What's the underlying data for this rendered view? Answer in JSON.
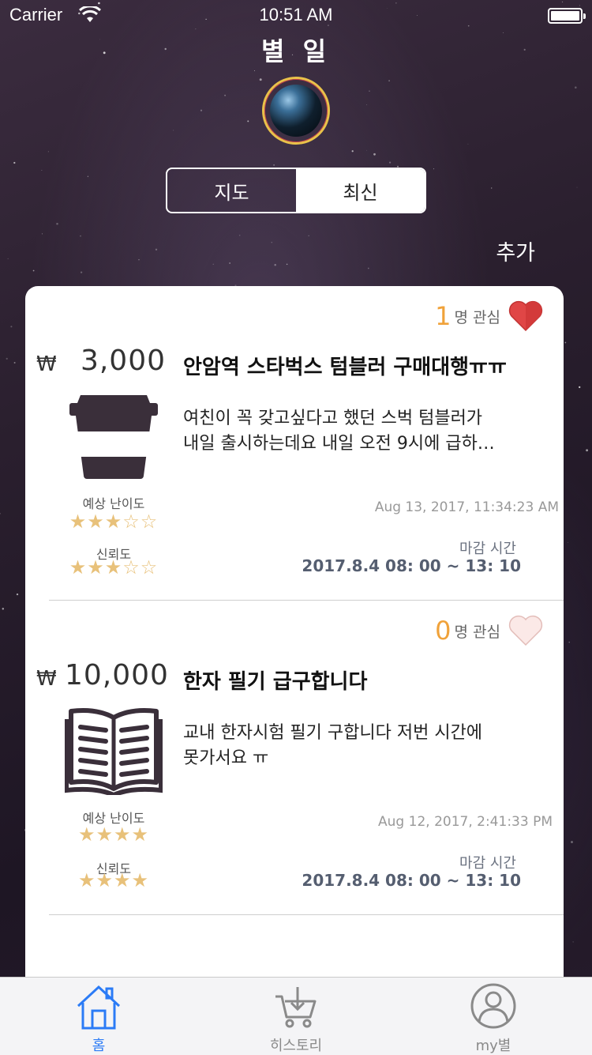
{
  "status_bar": {
    "carrier": "Carrier",
    "time": "10:51 AM",
    "battery_level": 1.0
  },
  "header": {
    "title": "별 일"
  },
  "segmented_control": {
    "map_label": "지도",
    "latest_label": "최신",
    "selected": "최신"
  },
  "add_label": "추가",
  "currency_symbol": "₩",
  "posts": [
    {
      "interest_count": "1",
      "interest_label": "명 관심",
      "liked": true,
      "price": "3,000",
      "title": "안암역 스타벅스 텀블러 구매대행ㅠㅠ",
      "icon": "coffee-cup-icon",
      "desc_line1": "여친이 꼭 갖고싶다고 했던 스벅 텀블러가",
      "desc_line2": "내일 출시하는데요 내일 오전 9시에 급하…",
      "difficulty_label": "예상 난이도",
      "difficulty_stars": "★★★☆☆",
      "difficulty_rating": 3,
      "trust_label": "신뢰도",
      "trust_stars": "★★★☆☆",
      "trust_rating": 3,
      "timestamp": "Aug 13, 2017, 11:34:23 AM",
      "deadline_label": "마감 시간",
      "deadline_value": "2017.8.4 08: 00 ~  13: 10"
    },
    {
      "interest_count": "0",
      "interest_label": "명 관심",
      "liked": false,
      "price": "10,000",
      "title": "한자 필기 급구합니다",
      "icon": "open-book-icon",
      "desc_line1": "교내 한자시험 필기 구합니다 저번 시간에",
      "desc_line2": "못가서요 ㅠ",
      "difficulty_label": "예상 난이도",
      "difficulty_stars": "★★★★",
      "difficulty_rating": 4,
      "trust_label": "신뢰도",
      "trust_stars": "★★★★",
      "trust_rating": 4,
      "timestamp": "Aug 12, 2017, 2:41:33 PM",
      "deadline_label": "마감 시간",
      "deadline_value": "2017.8.4 08: 00 ~  13: 10"
    }
  ],
  "tabbar": {
    "home_label": "홈",
    "history_label": "히스토리",
    "my_label": "my별",
    "active": "홈"
  },
  "colors": {
    "accent": "#2b7bf6",
    "heart": "#e04646",
    "interest_count": "#f0a23a",
    "star": "#e8c17a"
  }
}
